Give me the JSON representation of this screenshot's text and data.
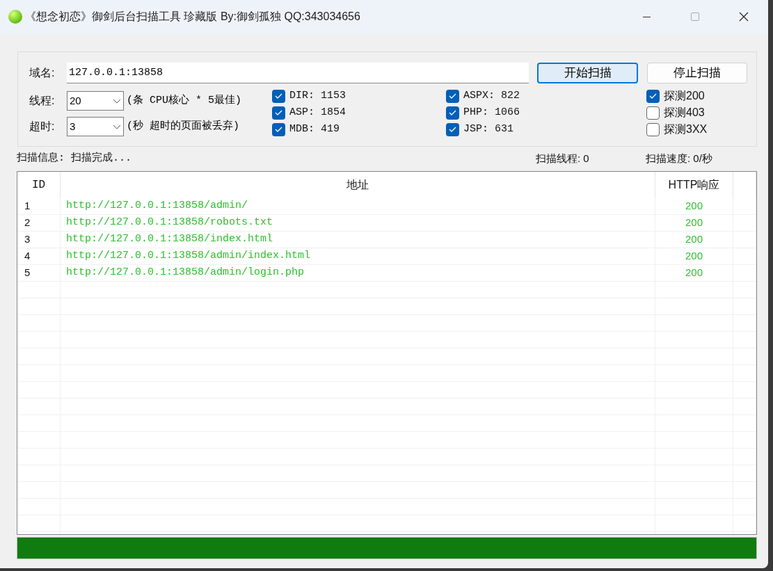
{
  "window": {
    "title": "《想念初恋》御剑后台扫描工具 珍藏版 By:御剑孤独 QQ:343034656"
  },
  "domain": {
    "label": "域名:",
    "value": "127.0.0.1:13858"
  },
  "buttons": [
    {
      "label": "开始扫描",
      "focused": true
    },
    {
      "label": "停止扫描",
      "focused": false
    }
  ],
  "threads": {
    "label": "线程:",
    "value": "20",
    "hint": "(条 CPU核心 * 5最佳)"
  },
  "timeout": {
    "label": "超时:",
    "value": "3",
    "hint": "(秒 超时的页面被丢弃)"
  },
  "dictionaries": [
    {
      "label": "DIR: 1153",
      "checked": true
    },
    {
      "label": "ASP: 1854",
      "checked": true
    },
    {
      "label": "MDB: 419",
      "checked": true
    },
    {
      "label": "ASPX: 822",
      "checked": true
    },
    {
      "label": "PHP: 1066",
      "checked": true
    },
    {
      "label": "JSP: 631",
      "checked": true
    }
  ],
  "probes": [
    {
      "label": "探测200",
      "checked": true
    },
    {
      "label": "探测403",
      "checked": false
    },
    {
      "label": "探测3XX",
      "checked": false
    }
  ],
  "status": {
    "info": "扫描信息: 扫描完成...",
    "threads": "扫描线程: 0",
    "speed": "扫描速度: 0/秒"
  },
  "table": {
    "columns": [
      "ID",
      "地址",
      "HTTP响应"
    ],
    "rows": [
      [
        "1",
        "http://127.0.0.1:13858/admin/",
        "200"
      ],
      [
        "2",
        "http://127.0.0.1:13858/robots.txt",
        "200"
      ],
      [
        "3",
        "http://127.0.0.1:13858/index.html",
        "200"
      ],
      [
        "4",
        "http://127.0.0.1:13858/admin/index.html",
        "200"
      ],
      [
        "5",
        "http://127.0.0.1:13858/admin/login.php",
        "200"
      ]
    ]
  },
  "progress": {
    "level": 1
  }
}
